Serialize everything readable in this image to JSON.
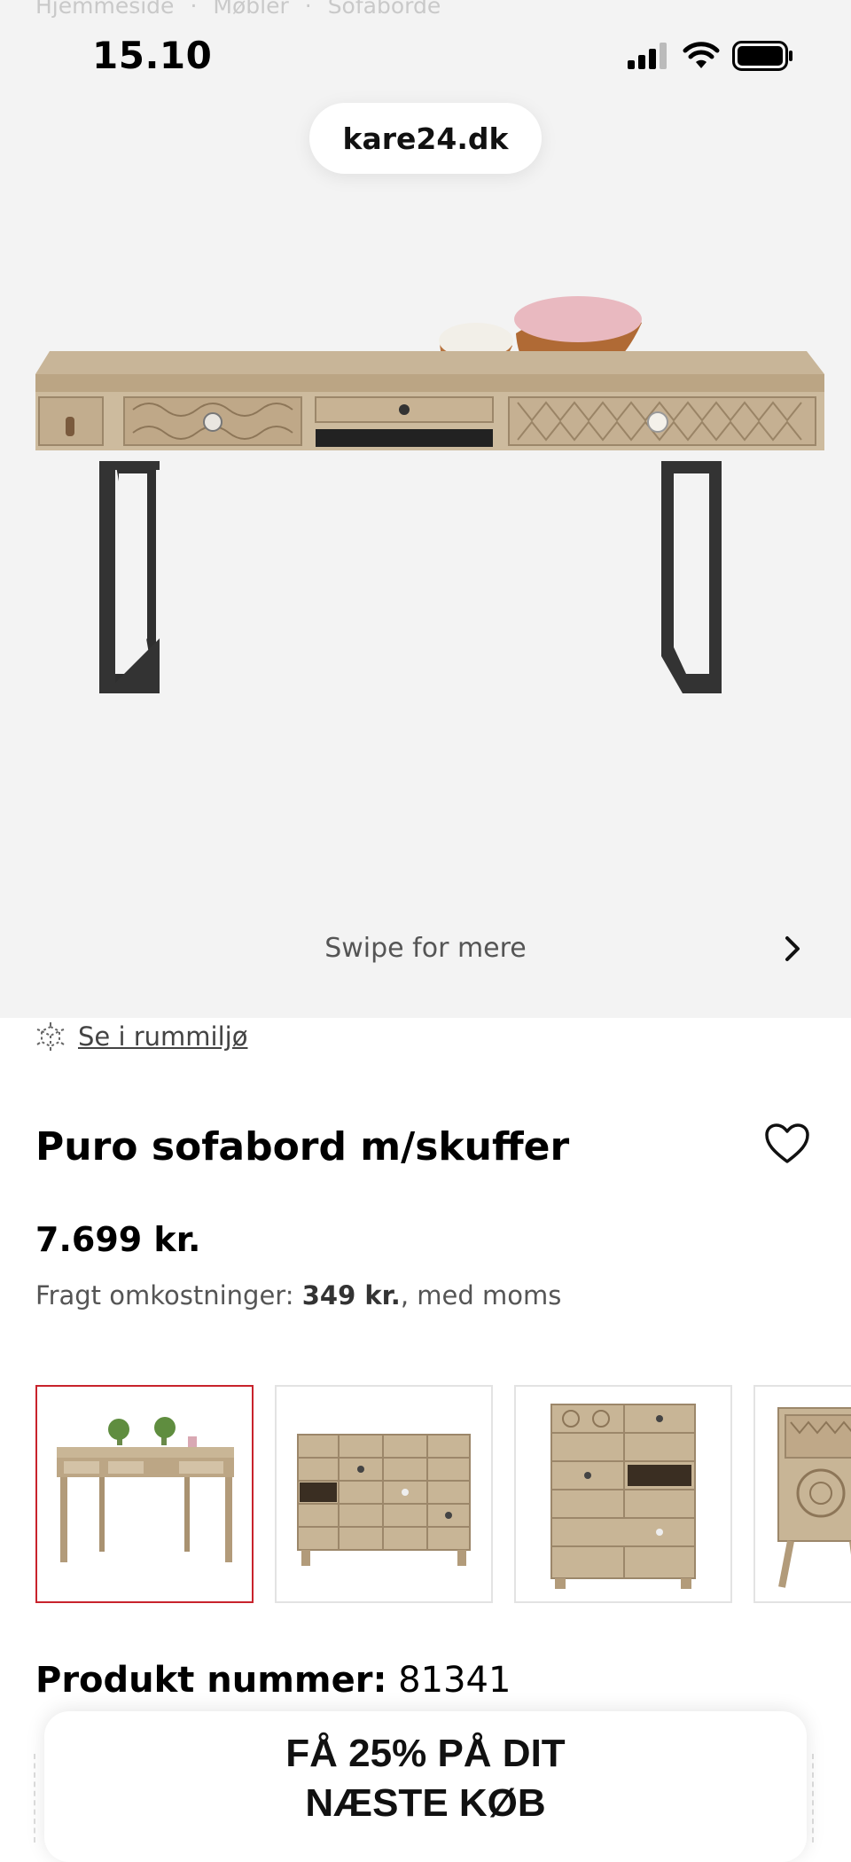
{
  "breadcrumb": [
    "Hjemmeside",
    "Møbler",
    "Sofaborde"
  ],
  "status_bar": {
    "time": "15.10",
    "icons": [
      "signal-icon",
      "wifi-icon",
      "battery-icon"
    ]
  },
  "browser": {
    "url": "kare24.dk"
  },
  "gallery": {
    "swipe_label": "Swipe for mere",
    "next_icon": "chevron-right-icon"
  },
  "room_view": {
    "icon": "ar-cube-icon",
    "label": "Se i rummiljø"
  },
  "product": {
    "title": "Puro sofabord m/skuffer",
    "price": "7.699 kr.",
    "shipping_prefix": "Fragt omkostninger: ",
    "shipping_amount": "349 kr.",
    "shipping_suffix": ", med moms",
    "number_label": "Produkt nummer:",
    "number_value": "81341"
  },
  "wishlist": {
    "icon": "heart-icon"
  },
  "thumbnails": [
    {
      "name": "desk",
      "selected": true
    },
    {
      "name": "sideboard",
      "selected": false
    },
    {
      "name": "chest-of-drawers",
      "selected": false
    },
    {
      "name": "cabinet",
      "selected": false
    }
  ],
  "promo": {
    "line1": "FÅ 25% PÅ DIT",
    "line2": "NÆSTE KØB"
  },
  "colors": {
    "accent_selected": "#c8232c",
    "hero_bg": "#f3f3f3",
    "wood": "#cbb89c",
    "metal": "#2e2e2e"
  }
}
